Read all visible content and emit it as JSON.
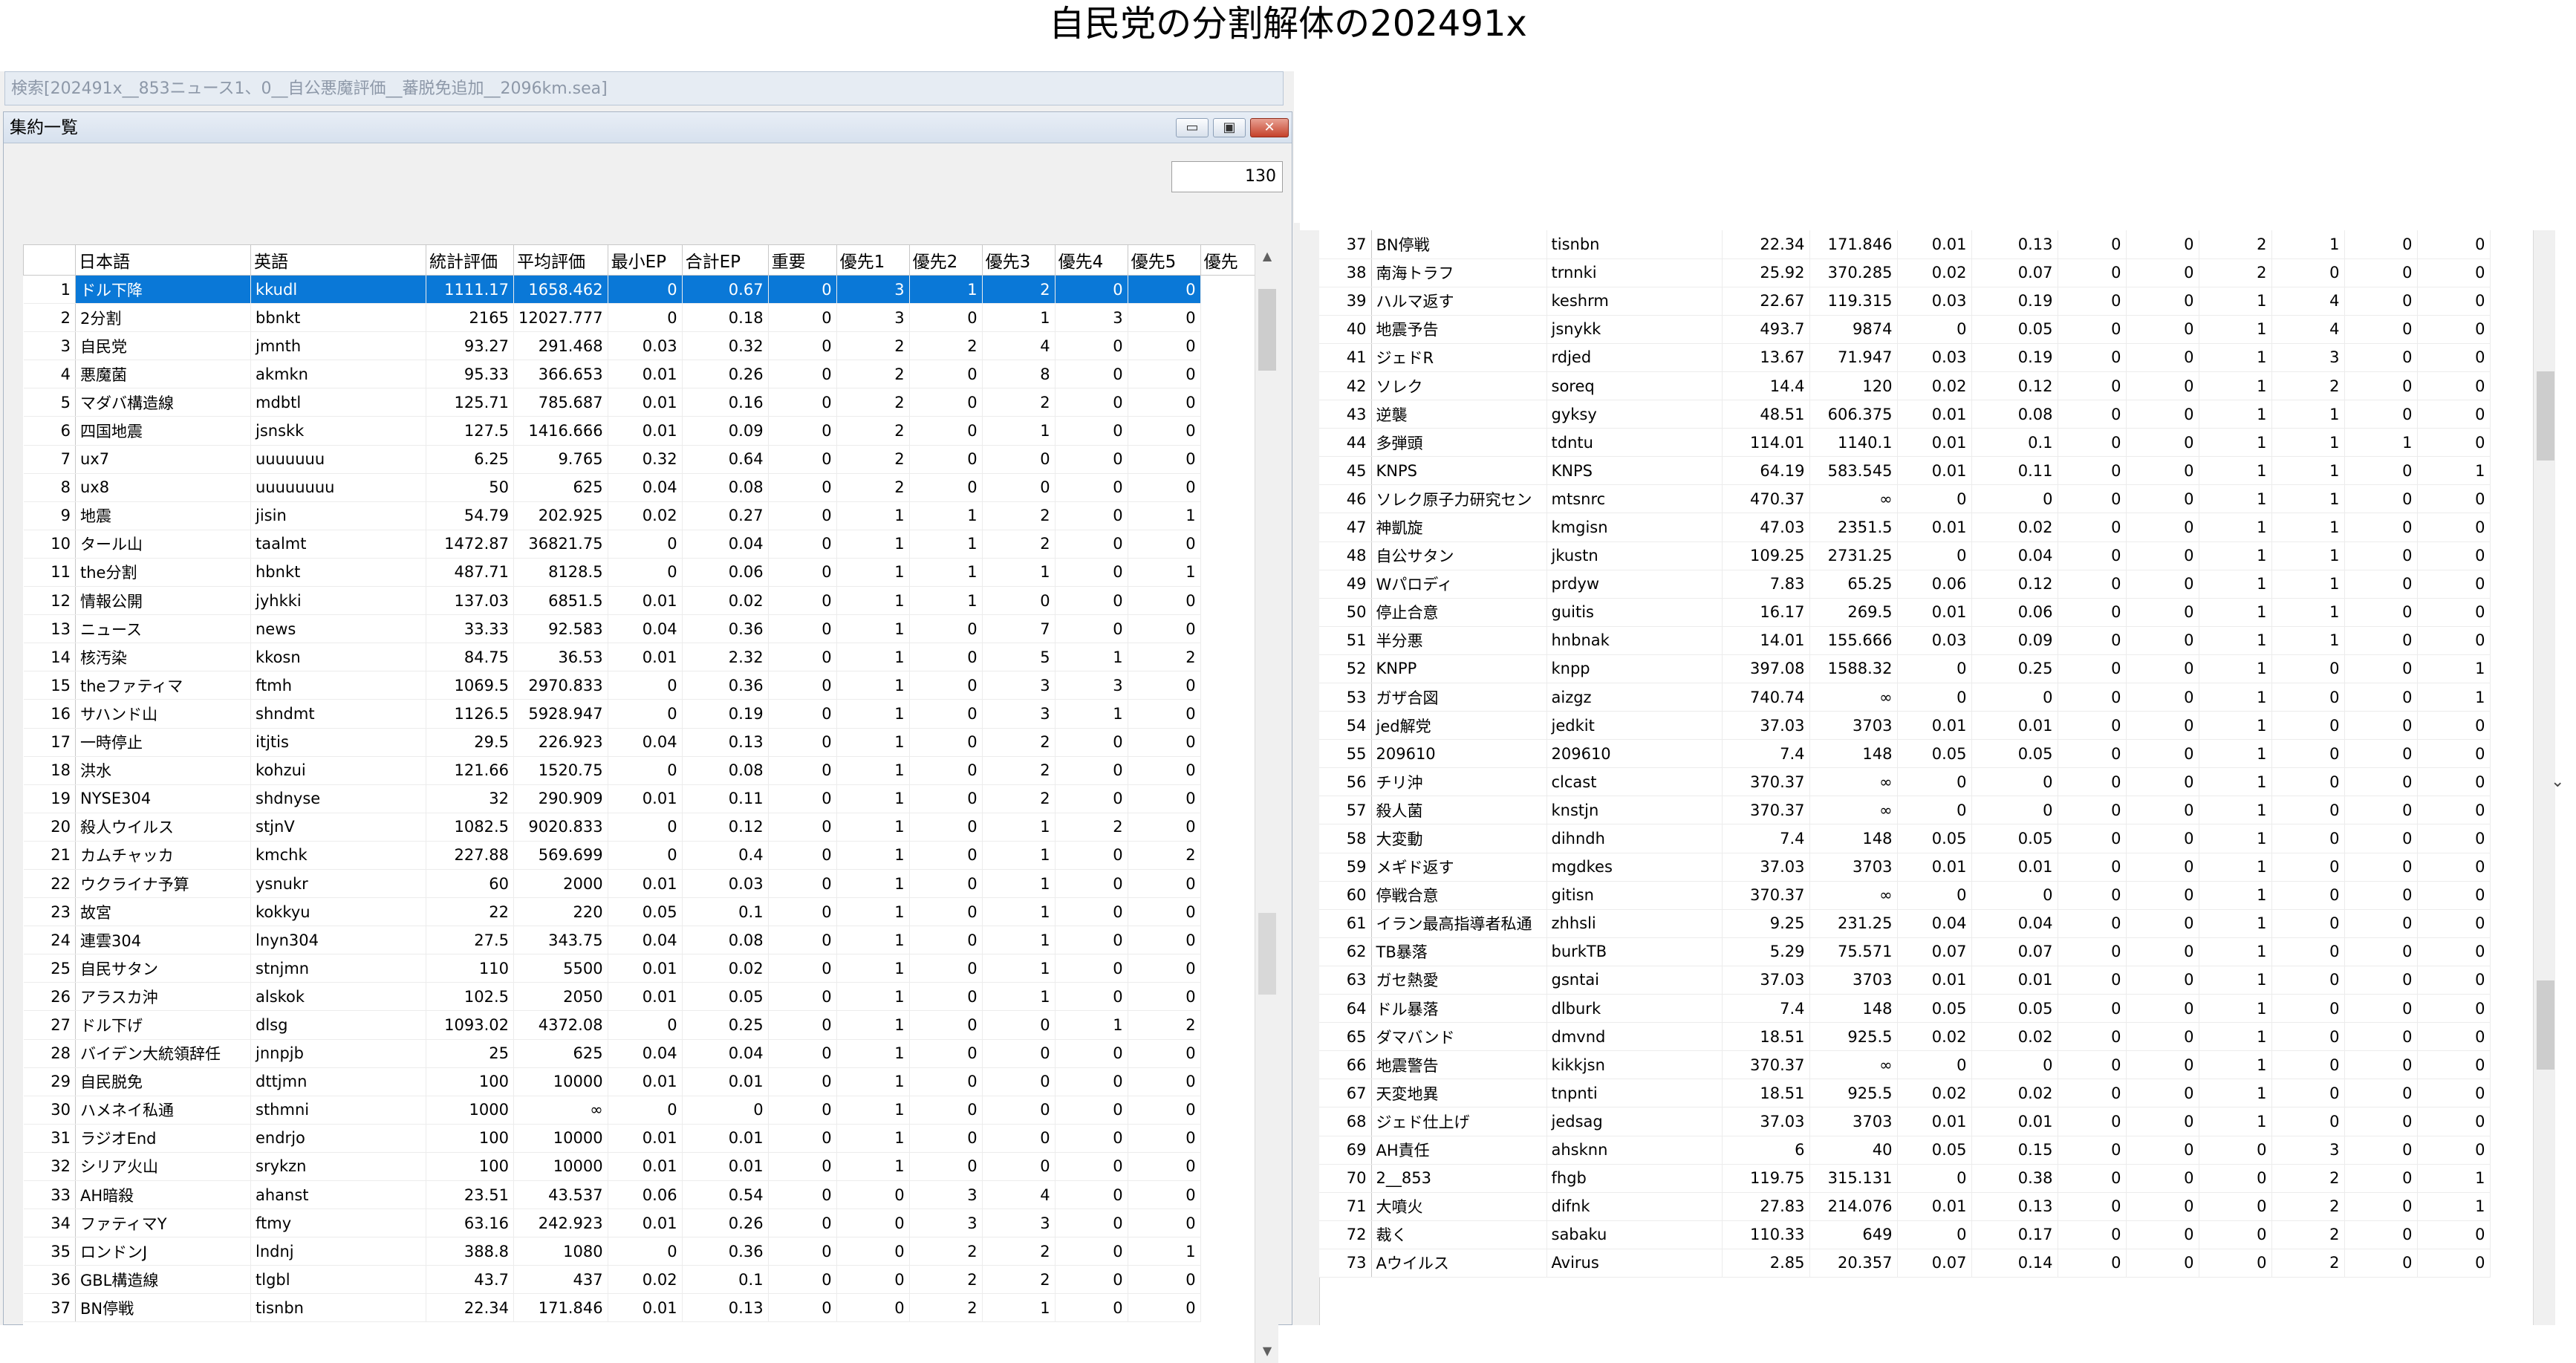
{
  "heading": "自民党の分割解体の202491x",
  "window": {
    "search_title": "検索[202491x__853ニュース1、0__自公悪魔評価__蕃脱免追加__2096km.sea]",
    "subwindow_title": "集約一覧",
    "buttons": {
      "minimize": "▭",
      "maximize": "▣",
      "close": "✕"
    },
    "record_count": "130"
  },
  "columns": [
    "日本語",
    "英語",
    "統計評価",
    "平均評価",
    "最小EP",
    "合計EP",
    "重要",
    "優先1",
    "優先2",
    "優先3",
    "優先4",
    "優先5",
    "優先"
  ],
  "left_rows": [
    [
      "1",
      "ドル下降",
      "kkudl",
      "1111.17",
      "1658.462",
      "0",
      "0.67",
      "0",
      "3",
      "1",
      "2",
      "0",
      "0"
    ],
    [
      "2",
      "2分割",
      "bbnkt",
      "2165",
      "12027.777",
      "0",
      "0.18",
      "0",
      "3",
      "0",
      "1",
      "3",
      "0"
    ],
    [
      "3",
      "自民党",
      "jmnth",
      "93.27",
      "291.468",
      "0.03",
      "0.32",
      "0",
      "2",
      "2",
      "4",
      "0",
      "0"
    ],
    [
      "4",
      "悪魔菌",
      "akmkn",
      "95.33",
      "366.653",
      "0.01",
      "0.26",
      "0",
      "2",
      "0",
      "8",
      "0",
      "0"
    ],
    [
      "5",
      "マダバ構造線",
      "mdbtl",
      "125.71",
      "785.687",
      "0.01",
      "0.16",
      "0",
      "2",
      "0",
      "2",
      "0",
      "0"
    ],
    [
      "6",
      "四国地震",
      "jsnskk",
      "127.5",
      "1416.666",
      "0.01",
      "0.09",
      "0",
      "2",
      "0",
      "1",
      "0",
      "0"
    ],
    [
      "7",
      "ux7",
      "uuuuuuu",
      "6.25",
      "9.765",
      "0.32",
      "0.64",
      "0",
      "2",
      "0",
      "0",
      "0",
      "0"
    ],
    [
      "8",
      "ux8",
      "uuuuuuuu",
      "50",
      "625",
      "0.04",
      "0.08",
      "0",
      "2",
      "0",
      "0",
      "0",
      "0"
    ],
    [
      "9",
      "地震",
      "jisin",
      "54.79",
      "202.925",
      "0.02",
      "0.27",
      "0",
      "1",
      "1",
      "2",
      "0",
      "1"
    ],
    [
      "10",
      "タール山",
      "taalmt",
      "1472.87",
      "36821.75",
      "0",
      "0.04",
      "0",
      "1",
      "1",
      "2",
      "0",
      "0"
    ],
    [
      "11",
      "the分割",
      "hbnkt",
      "487.71",
      "8128.5",
      "0",
      "0.06",
      "0",
      "1",
      "1",
      "1",
      "0",
      "1"
    ],
    [
      "12",
      "情報公開",
      "jyhkki",
      "137.03",
      "6851.5",
      "0.01",
      "0.02",
      "0",
      "1",
      "1",
      "0",
      "0",
      "0"
    ],
    [
      "13",
      "ニュース",
      "news",
      "33.33",
      "92.583",
      "0.04",
      "0.36",
      "0",
      "1",
      "0",
      "7",
      "0",
      "0"
    ],
    [
      "14",
      "核汚染",
      "kkosn",
      "84.75",
      "36.53",
      "0.01",
      "2.32",
      "0",
      "1",
      "0",
      "5",
      "1",
      "2"
    ],
    [
      "15",
      "theファティマ",
      "ftmh",
      "1069.5",
      "2970.833",
      "0",
      "0.36",
      "0",
      "1",
      "0",
      "3",
      "3",
      "0"
    ],
    [
      "16",
      "サハンド山",
      "shndmt",
      "1126.5",
      "5928.947",
      "0",
      "0.19",
      "0",
      "1",
      "0",
      "3",
      "1",
      "0"
    ],
    [
      "17",
      "一時停止",
      "itjtis",
      "29.5",
      "226.923",
      "0.04",
      "0.13",
      "0",
      "1",
      "0",
      "2",
      "0",
      "0"
    ],
    [
      "18",
      "洪水",
      "kohzui",
      "121.66",
      "1520.75",
      "0",
      "0.08",
      "0",
      "1",
      "0",
      "2",
      "0",
      "0"
    ],
    [
      "19",
      "NYSE304",
      "shdnyse",
      "32",
      "290.909",
      "0.01",
      "0.11",
      "0",
      "1",
      "0",
      "2",
      "0",
      "0"
    ],
    [
      "20",
      "殺人ウイルス",
      "stjnV",
      "1082.5",
      "9020.833",
      "0",
      "0.12",
      "0",
      "1",
      "0",
      "1",
      "2",
      "0"
    ],
    [
      "21",
      "カムチャッカ",
      "kmchk",
      "227.88",
      "569.699",
      "0",
      "0.4",
      "0",
      "1",
      "0",
      "1",
      "0",
      "2"
    ],
    [
      "22",
      "ウクライナ予算",
      "ysnukr",
      "60",
      "2000",
      "0.01",
      "0.03",
      "0",
      "1",
      "0",
      "1",
      "0",
      "0"
    ],
    [
      "23",
      "故宮",
      "kokkyu",
      "22",
      "220",
      "0.05",
      "0.1",
      "0",
      "1",
      "0",
      "1",
      "0",
      "0"
    ],
    [
      "24",
      "連雲304",
      "lnyn304",
      "27.5",
      "343.75",
      "0.04",
      "0.08",
      "0",
      "1",
      "0",
      "1",
      "0",
      "0"
    ],
    [
      "25",
      "自民サタン",
      "stnjmn",
      "110",
      "5500",
      "0.01",
      "0.02",
      "0",
      "1",
      "0",
      "1",
      "0",
      "0"
    ],
    [
      "26",
      "アラスカ沖",
      "alskok",
      "102.5",
      "2050",
      "0.01",
      "0.05",
      "0",
      "1",
      "0",
      "1",
      "0",
      "0"
    ],
    [
      "27",
      "ドル下げ",
      "dlsg",
      "1093.02",
      "4372.08",
      "0",
      "0.25",
      "0",
      "1",
      "0",
      "0",
      "1",
      "2"
    ],
    [
      "28",
      "バイデン大統領辞任",
      "jnnpjb",
      "25",
      "625",
      "0.04",
      "0.04",
      "0",
      "1",
      "0",
      "0",
      "0",
      "0"
    ],
    [
      "29",
      "自民脱免",
      "dttjmn",
      "100",
      "10000",
      "0.01",
      "0.01",
      "0",
      "1",
      "0",
      "0",
      "0",
      "0"
    ],
    [
      "30",
      "ハメネイ私通",
      "sthmni",
      "1000",
      "∞",
      "0",
      "0",
      "0",
      "1",
      "0",
      "0",
      "0",
      "0"
    ],
    [
      "31",
      "ラジオEnd",
      "endrjo",
      "100",
      "10000",
      "0.01",
      "0.01",
      "0",
      "1",
      "0",
      "0",
      "0",
      "0"
    ],
    [
      "32",
      "シリア火山",
      "srykzn",
      "100",
      "10000",
      "0.01",
      "0.01",
      "0",
      "1",
      "0",
      "0",
      "0",
      "0"
    ],
    [
      "33",
      "AH暗殺",
      "ahanst",
      "23.51",
      "43.537",
      "0.06",
      "0.54",
      "0",
      "0",
      "3",
      "4",
      "0",
      "0"
    ],
    [
      "34",
      "ファティマY",
      "ftmy",
      "63.16",
      "242.923",
      "0.01",
      "0.26",
      "0",
      "0",
      "3",
      "3",
      "0",
      "0"
    ],
    [
      "35",
      "ロンドンJ",
      "lndnj",
      "388.8",
      "1080",
      "0",
      "0.36",
      "0",
      "0",
      "2",
      "2",
      "0",
      "1"
    ],
    [
      "36",
      "GBL構造線",
      "tlgbl",
      "43.7",
      "437",
      "0.02",
      "0.1",
      "0",
      "0",
      "2",
      "2",
      "0",
      "0"
    ],
    [
      "37",
      "BN停戦",
      "tisnbn",
      "22.34",
      "171.846",
      "0.01",
      "0.13",
      "0",
      "0",
      "2",
      "1",
      "0",
      "0"
    ]
  ],
  "right_rows": [
    [
      "37",
      "BN停戦",
      "tisnbn",
      "22.34",
      "171.846",
      "0.01",
      "0.13",
      "0",
      "0",
      "2",
      "1",
      "0",
      "0"
    ],
    [
      "38",
      "南海トラフ",
      "trnnki",
      "25.92",
      "370.285",
      "0.02",
      "0.07",
      "0",
      "0",
      "2",
      "0",
      "0",
      "0"
    ],
    [
      "39",
      "ハルマ返す",
      "keshrm",
      "22.67",
      "119.315",
      "0.03",
      "0.19",
      "0",
      "0",
      "1",
      "4",
      "0",
      "0"
    ],
    [
      "40",
      "地震予告",
      "jsnykk",
      "493.7",
      "9874",
      "0",
      "0.05",
      "0",
      "0",
      "1",
      "4",
      "0",
      "0"
    ],
    [
      "41",
      "ジェドR",
      "rdjed",
      "13.67",
      "71.947",
      "0.03",
      "0.19",
      "0",
      "0",
      "1",
      "3",
      "0",
      "0"
    ],
    [
      "42",
      "ソレク",
      "soreq",
      "14.4",
      "120",
      "0.02",
      "0.12",
      "0",
      "0",
      "1",
      "2",
      "0",
      "0"
    ],
    [
      "43",
      "逆襲",
      "gyksy",
      "48.51",
      "606.375",
      "0.01",
      "0.08",
      "0",
      "0",
      "1",
      "1",
      "0",
      "0"
    ],
    [
      "44",
      "多弾頭",
      "tdntu",
      "114.01",
      "1140.1",
      "0.01",
      "0.1",
      "0",
      "0",
      "1",
      "1",
      "1",
      "0"
    ],
    [
      "45",
      "KNPS",
      "KNPS",
      "64.19",
      "583.545",
      "0.01",
      "0.11",
      "0",
      "0",
      "1",
      "1",
      "0",
      "1"
    ],
    [
      "46",
      "ソレク原子力研究セン",
      "mtsnrc",
      "470.37",
      "∞",
      "0",
      "0",
      "0",
      "0",
      "1",
      "1",
      "0",
      "0"
    ],
    [
      "47",
      "神凱旋",
      "kmgisn",
      "47.03",
      "2351.5",
      "0.01",
      "0.02",
      "0",
      "0",
      "1",
      "1",
      "0",
      "0"
    ],
    [
      "48",
      "自公サタン",
      "jkustn",
      "109.25",
      "2731.25",
      "0",
      "0.04",
      "0",
      "0",
      "1",
      "1",
      "0",
      "0"
    ],
    [
      "49",
      "Wパロディ",
      "prdyw",
      "7.83",
      "65.25",
      "0.06",
      "0.12",
      "0",
      "0",
      "1",
      "1",
      "0",
      "0"
    ],
    [
      "50",
      "停止合意",
      "guitis",
      "16.17",
      "269.5",
      "0.01",
      "0.06",
      "0",
      "0",
      "1",
      "1",
      "0",
      "0"
    ],
    [
      "51",
      "半分悪",
      "hnbnak",
      "14.01",
      "155.666",
      "0.03",
      "0.09",
      "0",
      "0",
      "1",
      "1",
      "0",
      "0"
    ],
    [
      "52",
      "KNPP",
      "knpp",
      "397.08",
      "1588.32",
      "0",
      "0.25",
      "0",
      "0",
      "1",
      "0",
      "0",
      "1"
    ],
    [
      "53",
      "ガザ合図",
      "aizgz",
      "740.74",
      "∞",
      "0",
      "0",
      "0",
      "0",
      "1",
      "0",
      "0",
      "1"
    ],
    [
      "54",
      "jed解党",
      "jedkit",
      "37.03",
      "3703",
      "0.01",
      "0.01",
      "0",
      "0",
      "1",
      "0",
      "0",
      "0"
    ],
    [
      "55",
      "209610",
      "209610",
      "7.4",
      "148",
      "0.05",
      "0.05",
      "0",
      "0",
      "1",
      "0",
      "0",
      "0"
    ],
    [
      "56",
      "チリ沖",
      "clcast",
      "370.37",
      "∞",
      "0",
      "0",
      "0",
      "0",
      "1",
      "0",
      "0",
      "0"
    ],
    [
      "57",
      "殺人菌",
      "knstjn",
      "370.37",
      "∞",
      "0",
      "0",
      "0",
      "0",
      "1",
      "0",
      "0",
      "0"
    ],
    [
      "58",
      "大変動",
      "dihndh",
      "7.4",
      "148",
      "0.05",
      "0.05",
      "0",
      "0",
      "1",
      "0",
      "0",
      "0"
    ],
    [
      "59",
      "メギド返す",
      "mgdkes",
      "37.03",
      "3703",
      "0.01",
      "0.01",
      "0",
      "0",
      "1",
      "0",
      "0",
      "0"
    ],
    [
      "60",
      "停戦合意",
      "gitisn",
      "370.37",
      "∞",
      "0",
      "0",
      "0",
      "0",
      "1",
      "0",
      "0",
      "0"
    ],
    [
      "61",
      "イラン最高指導者私通",
      "zhhsli",
      "9.25",
      "231.25",
      "0.04",
      "0.04",
      "0",
      "0",
      "1",
      "0",
      "0",
      "0"
    ],
    [
      "62",
      "TB暴落",
      "burkTB",
      "5.29",
      "75.571",
      "0.07",
      "0.07",
      "0",
      "0",
      "1",
      "0",
      "0",
      "0"
    ],
    [
      "63",
      "ガセ熱愛",
      "gsntai",
      "37.03",
      "3703",
      "0.01",
      "0.01",
      "0",
      "0",
      "1",
      "0",
      "0",
      "0"
    ],
    [
      "64",
      "ドル暴落",
      "dlburk",
      "7.4",
      "148",
      "0.05",
      "0.05",
      "0",
      "0",
      "1",
      "0",
      "0",
      "0"
    ],
    [
      "65",
      "ダマバンド",
      "dmvnd",
      "18.51",
      "925.5",
      "0.02",
      "0.02",
      "0",
      "0",
      "1",
      "0",
      "0",
      "0"
    ],
    [
      "66",
      "地震警告",
      "kikkjsn",
      "370.37",
      "∞",
      "0",
      "0",
      "0",
      "0",
      "1",
      "0",
      "0",
      "0"
    ],
    [
      "67",
      "天変地異",
      "tnpnti",
      "18.51",
      "925.5",
      "0.02",
      "0.02",
      "0",
      "0",
      "1",
      "0",
      "0",
      "0"
    ],
    [
      "68",
      "ジェド仕上げ",
      "jedsag",
      "37.03",
      "3703",
      "0.01",
      "0.01",
      "0",
      "0",
      "1",
      "0",
      "0",
      "0"
    ],
    [
      "69",
      "AH責任",
      "ahsknn",
      "6",
      "40",
      "0.05",
      "0.15",
      "0",
      "0",
      "0",
      "3",
      "0",
      "0"
    ],
    [
      "70",
      "2__853",
      "fhgb",
      "119.75",
      "315.131",
      "0",
      "0.38",
      "0",
      "0",
      "0",
      "2",
      "0",
      "1"
    ],
    [
      "71",
      "大噴火",
      "difnk",
      "27.83",
      "214.076",
      "0.01",
      "0.13",
      "0",
      "0",
      "0",
      "2",
      "0",
      "1"
    ],
    [
      "72",
      "裁く",
      "sabaku",
      "110.33",
      "649",
      "0",
      "0.17",
      "0",
      "0",
      "0",
      "2",
      "0",
      "0"
    ],
    [
      "73",
      "Aウイルス",
      "Avirus",
      "2.85",
      "20.357",
      "0.07",
      "0.14",
      "0",
      "0",
      "0",
      "2",
      "0",
      "0"
    ]
  ]
}
